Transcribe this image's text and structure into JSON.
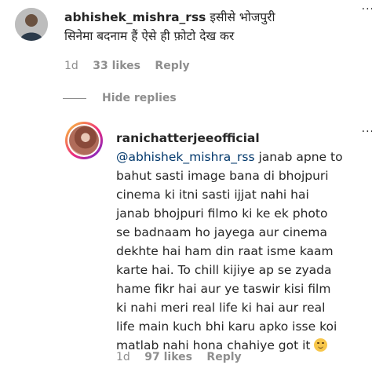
{
  "comment1": {
    "username": "abhishek_mishra_rss",
    "text": "इसीसे भोजपुरी सिनेमा बदनाम हैं ऐसे ही फ़ोटो देख कर",
    "time": "1d",
    "likes": "33 likes",
    "reply": "Reply"
  },
  "hide_replies": "Hide replies",
  "comment2": {
    "username": "ranichatterjeeofficial",
    "mention": "@abhishek_mishra_rss",
    "text": " janab apne to bahut sasti image bana di bhojpuri cinema ki itni sasti ijjat nahi hai janab bhojpuri filmo ki ke ek photo se badnaam ho jayega aur cinema dekhte hai ham din raat isme kaam karte hai. To chill kijiye ap se zyada hame fikr hai aur ye taswir kisi film ki nahi meri real life ki hai aur real life main kuch bhi karu apko isse koi matlab nahi hona chahiye got it",
    "emoji": "smirking-face",
    "time": "1d",
    "likes": "97 likes",
    "reply": "Reply"
  }
}
